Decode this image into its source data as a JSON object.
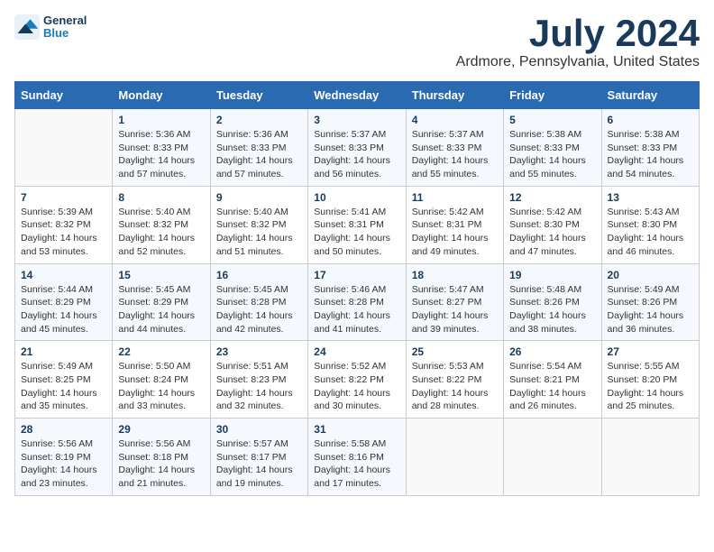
{
  "header": {
    "logo_general": "General",
    "logo_blue": "Blue",
    "month": "July 2024",
    "location": "Ardmore, Pennsylvania, United States"
  },
  "weekdays": [
    "Sunday",
    "Monday",
    "Tuesday",
    "Wednesday",
    "Thursday",
    "Friday",
    "Saturday"
  ],
  "weeks": [
    [
      {
        "day": "",
        "sunrise": "",
        "sunset": "",
        "daylight": ""
      },
      {
        "day": "1",
        "sunrise": "Sunrise: 5:36 AM",
        "sunset": "Sunset: 8:33 PM",
        "daylight": "Daylight: 14 hours and 57 minutes."
      },
      {
        "day": "2",
        "sunrise": "Sunrise: 5:36 AM",
        "sunset": "Sunset: 8:33 PM",
        "daylight": "Daylight: 14 hours and 57 minutes."
      },
      {
        "day": "3",
        "sunrise": "Sunrise: 5:37 AM",
        "sunset": "Sunset: 8:33 PM",
        "daylight": "Daylight: 14 hours and 56 minutes."
      },
      {
        "day": "4",
        "sunrise": "Sunrise: 5:37 AM",
        "sunset": "Sunset: 8:33 PM",
        "daylight": "Daylight: 14 hours and 55 minutes."
      },
      {
        "day": "5",
        "sunrise": "Sunrise: 5:38 AM",
        "sunset": "Sunset: 8:33 PM",
        "daylight": "Daylight: 14 hours and 55 minutes."
      },
      {
        "day": "6",
        "sunrise": "Sunrise: 5:38 AM",
        "sunset": "Sunset: 8:33 PM",
        "daylight": "Daylight: 14 hours and 54 minutes."
      }
    ],
    [
      {
        "day": "7",
        "sunrise": "Sunrise: 5:39 AM",
        "sunset": "Sunset: 8:32 PM",
        "daylight": "Daylight: 14 hours and 53 minutes."
      },
      {
        "day": "8",
        "sunrise": "Sunrise: 5:40 AM",
        "sunset": "Sunset: 8:32 PM",
        "daylight": "Daylight: 14 hours and 52 minutes."
      },
      {
        "day": "9",
        "sunrise": "Sunrise: 5:40 AM",
        "sunset": "Sunset: 8:32 PM",
        "daylight": "Daylight: 14 hours and 51 minutes."
      },
      {
        "day": "10",
        "sunrise": "Sunrise: 5:41 AM",
        "sunset": "Sunset: 8:31 PM",
        "daylight": "Daylight: 14 hours and 50 minutes."
      },
      {
        "day": "11",
        "sunrise": "Sunrise: 5:42 AM",
        "sunset": "Sunset: 8:31 PM",
        "daylight": "Daylight: 14 hours and 49 minutes."
      },
      {
        "day": "12",
        "sunrise": "Sunrise: 5:42 AM",
        "sunset": "Sunset: 8:30 PM",
        "daylight": "Daylight: 14 hours and 47 minutes."
      },
      {
        "day": "13",
        "sunrise": "Sunrise: 5:43 AM",
        "sunset": "Sunset: 8:30 PM",
        "daylight": "Daylight: 14 hours and 46 minutes."
      }
    ],
    [
      {
        "day": "14",
        "sunrise": "Sunrise: 5:44 AM",
        "sunset": "Sunset: 8:29 PM",
        "daylight": "Daylight: 14 hours and 45 minutes."
      },
      {
        "day": "15",
        "sunrise": "Sunrise: 5:45 AM",
        "sunset": "Sunset: 8:29 PM",
        "daylight": "Daylight: 14 hours and 44 minutes."
      },
      {
        "day": "16",
        "sunrise": "Sunrise: 5:45 AM",
        "sunset": "Sunset: 8:28 PM",
        "daylight": "Daylight: 14 hours and 42 minutes."
      },
      {
        "day": "17",
        "sunrise": "Sunrise: 5:46 AM",
        "sunset": "Sunset: 8:28 PM",
        "daylight": "Daylight: 14 hours and 41 minutes."
      },
      {
        "day": "18",
        "sunrise": "Sunrise: 5:47 AM",
        "sunset": "Sunset: 8:27 PM",
        "daylight": "Daylight: 14 hours and 39 minutes."
      },
      {
        "day": "19",
        "sunrise": "Sunrise: 5:48 AM",
        "sunset": "Sunset: 8:26 PM",
        "daylight": "Daylight: 14 hours and 38 minutes."
      },
      {
        "day": "20",
        "sunrise": "Sunrise: 5:49 AM",
        "sunset": "Sunset: 8:26 PM",
        "daylight": "Daylight: 14 hours and 36 minutes."
      }
    ],
    [
      {
        "day": "21",
        "sunrise": "Sunrise: 5:49 AM",
        "sunset": "Sunset: 8:25 PM",
        "daylight": "Daylight: 14 hours and 35 minutes."
      },
      {
        "day": "22",
        "sunrise": "Sunrise: 5:50 AM",
        "sunset": "Sunset: 8:24 PM",
        "daylight": "Daylight: 14 hours and 33 minutes."
      },
      {
        "day": "23",
        "sunrise": "Sunrise: 5:51 AM",
        "sunset": "Sunset: 8:23 PM",
        "daylight": "Daylight: 14 hours and 32 minutes."
      },
      {
        "day": "24",
        "sunrise": "Sunrise: 5:52 AM",
        "sunset": "Sunset: 8:22 PM",
        "daylight": "Daylight: 14 hours and 30 minutes."
      },
      {
        "day": "25",
        "sunrise": "Sunrise: 5:53 AM",
        "sunset": "Sunset: 8:22 PM",
        "daylight": "Daylight: 14 hours and 28 minutes."
      },
      {
        "day": "26",
        "sunrise": "Sunrise: 5:54 AM",
        "sunset": "Sunset: 8:21 PM",
        "daylight": "Daylight: 14 hours and 26 minutes."
      },
      {
        "day": "27",
        "sunrise": "Sunrise: 5:55 AM",
        "sunset": "Sunset: 8:20 PM",
        "daylight": "Daylight: 14 hours and 25 minutes."
      }
    ],
    [
      {
        "day": "28",
        "sunrise": "Sunrise: 5:56 AM",
        "sunset": "Sunset: 8:19 PM",
        "daylight": "Daylight: 14 hours and 23 minutes."
      },
      {
        "day": "29",
        "sunrise": "Sunrise: 5:56 AM",
        "sunset": "Sunset: 8:18 PM",
        "daylight": "Daylight: 14 hours and 21 minutes."
      },
      {
        "day": "30",
        "sunrise": "Sunrise: 5:57 AM",
        "sunset": "Sunset: 8:17 PM",
        "daylight": "Daylight: 14 hours and 19 minutes."
      },
      {
        "day": "31",
        "sunrise": "Sunrise: 5:58 AM",
        "sunset": "Sunset: 8:16 PM",
        "daylight": "Daylight: 14 hours and 17 minutes."
      },
      {
        "day": "",
        "sunrise": "",
        "sunset": "",
        "daylight": ""
      },
      {
        "day": "",
        "sunrise": "",
        "sunset": "",
        "daylight": ""
      },
      {
        "day": "",
        "sunrise": "",
        "sunset": "",
        "daylight": ""
      }
    ]
  ]
}
